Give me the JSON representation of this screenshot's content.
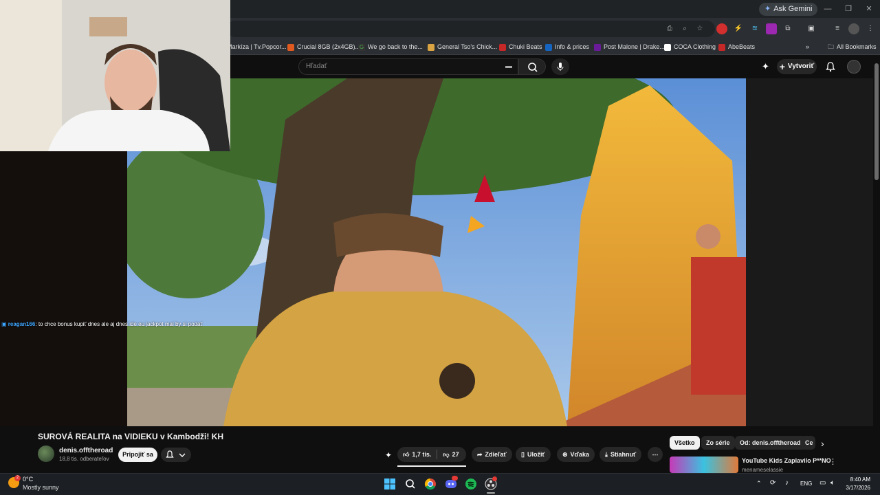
{
  "browser": {
    "ask_gemini": "Ask Gemini",
    "bookmarks": [
      {
        "label": "Markíza | Tv.Popcor...",
        "color": "#7a3f9c"
      },
      {
        "label": "Crucial 8GB (2x4GB)...",
        "color": "#e05a1f"
      },
      {
        "label": "We go back to the...",
        "color": "#4caf50"
      },
      {
        "label": "General Tso's Chick...",
        "color": "#d9a441"
      },
      {
        "label": "Chuki Beats",
        "color": "#c62828"
      },
      {
        "label": "Info & prices",
        "color": "#1565c0"
      },
      {
        "label": "Post Malone | Drake...",
        "color": "#6a1b9a"
      },
      {
        "label": "COCA Clothing",
        "color": "#ffffff"
      },
      {
        "label": "AbeBeats",
        "color": "#c62828"
      }
    ],
    "all_bookmarks": "All Bookmarks"
  },
  "youtube": {
    "search_placeholder": "Hľadať",
    "create_label": "Vytvoriť",
    "video_title": "SUROVÁ REALITA na VIDIEKU v Kambodži! KH",
    "channel_name": "denis.offtheroad",
    "subscribers": "18,8 tis. odberateľov",
    "join_label": "Pripojiť sa",
    "likes": "1,7 tis.",
    "dislikes": "27",
    "share_label": "Zdieľať",
    "save_label": "Uložiť",
    "thanks_label": "Vďaka",
    "download_label": "Stiahnuť",
    "chips": [
      "Všetko",
      "Zo série",
      "Od: denis.offtheroad",
      "Ce"
    ],
    "recommendation": {
      "title": "YouTube Kids Zaplavilo P**NO",
      "channel": "menameselassie"
    }
  },
  "chat": {
    "username": "reagan166",
    "message": ": to chce bonus kupiť dnes ale aj dnes ide eu jackpot mal by si podať"
  },
  "taskbar": {
    "temperature": "0°C",
    "condition": "Mostly sunny",
    "language": "ENG",
    "time": "8:40 AM",
    "date": "3/17/2026"
  },
  "colors": {
    "chrome_bg": "#2b2f33",
    "yt_bg": "#0f0f0f",
    "chip_active": "#f1f1f1"
  }
}
